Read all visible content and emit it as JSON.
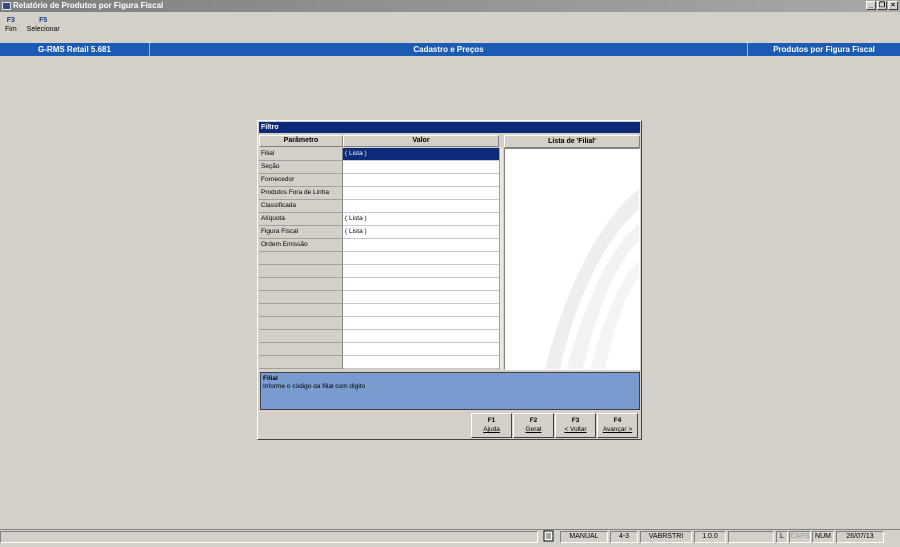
{
  "window": {
    "title": "Relatório de Produtos por Figura Fiscal"
  },
  "fkeys": [
    {
      "key": "F3",
      "label": "Fim"
    },
    {
      "key": "F5",
      "label": "Selecionar"
    }
  ],
  "header_band": {
    "left": "G-RMS Retail 5.681",
    "center": "Cadastro e Preços",
    "right": "Produtos por Figura Fiscal"
  },
  "dialog": {
    "title": "Filtro",
    "col_param": "Parâmetro",
    "col_valor": "Valor",
    "list_title": "Lista de 'Filial'",
    "rows": [
      {
        "param": "Filial",
        "valor": "( Lista )"
      },
      {
        "param": "Seção",
        "valor": ""
      },
      {
        "param": "Fornecedor",
        "valor": ""
      },
      {
        "param": "Produtos Fora de Linha",
        "valor": ""
      },
      {
        "param": "Classificada",
        "valor": ""
      },
      {
        "param": "Alíquota",
        "valor": "( Lista )"
      },
      {
        "param": "Figura Fiscal",
        "valor": "( Lista )"
      },
      {
        "param": "Ordem Emissão",
        "valor": ""
      },
      {
        "param": "",
        "valor": ""
      },
      {
        "param": "",
        "valor": ""
      },
      {
        "param": "",
        "valor": ""
      },
      {
        "param": "",
        "valor": ""
      },
      {
        "param": "",
        "valor": ""
      },
      {
        "param": "",
        "valor": ""
      },
      {
        "param": "",
        "valor": ""
      },
      {
        "param": "",
        "valor": ""
      },
      {
        "param": "",
        "valor": ""
      }
    ],
    "info": {
      "title": "Filial",
      "text": "Informe o código da filial com dígito"
    },
    "buttons": [
      {
        "key": "F1",
        "label": "Ajuda"
      },
      {
        "key": "F2",
        "label": "Geral"
      },
      {
        "key": "F3",
        "label": "< Voltar"
      },
      {
        "key": "F4",
        "label": "Avançar >"
      }
    ]
  },
  "status": {
    "mode": "MANUAL",
    "code": "4-3",
    "program": "VABRSTRI",
    "version": "1.0.0",
    "l": "L",
    "caps": "CAPS",
    "num": "NUM",
    "date": "26/07/13"
  },
  "colors": {
    "accent_blue": "#1c5bb5",
    "dialog_title": "#0c2a7a",
    "info_bg": "#7a9bd0"
  }
}
